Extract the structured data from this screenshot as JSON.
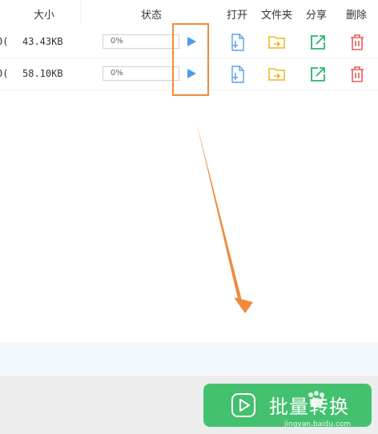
{
  "header": {
    "size": "大小",
    "status": "状态",
    "open": "打开",
    "folder": "文件夹",
    "share": "分享",
    "delete": "删除"
  },
  "rows": [
    {
      "cut": "0(",
      "size": "43.43KB",
      "progress": "0%",
      "progress_value": 0
    },
    {
      "cut": "0(",
      "size": "58.10KB",
      "progress": "0%",
      "progress_value": 0
    }
  ],
  "batch_button": {
    "label": "批量转换"
  },
  "watermark": {
    "text": "jingyan.baidu.com"
  },
  "colors": {
    "accent_green": "#44c16e",
    "highlight_orange": "#f08a3a",
    "play_blue": "#4a9ee8",
    "open_blue": "#5aa0e6",
    "folder_yellow": "#f2b51c",
    "share_green": "#2eb36a",
    "delete_red": "#e85a5a"
  },
  "icons": {
    "play": "play-icon",
    "open": "open-file-icon",
    "folder": "folder-icon",
    "share": "share-icon",
    "delete": "trash-icon",
    "batch": "play-circle-icon"
  }
}
